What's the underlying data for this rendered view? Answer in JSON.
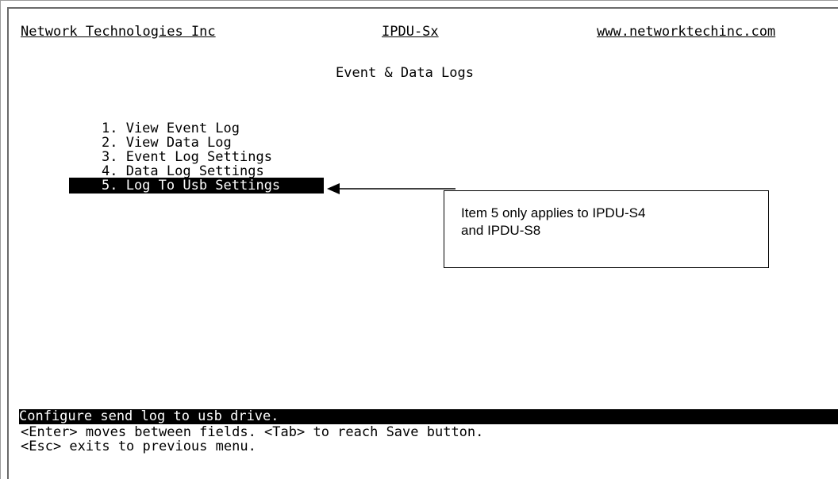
{
  "header": {
    "company": "Network Technologies Inc",
    "product": "IPDU-Sx",
    "website": "www.networktechinc.com"
  },
  "title": "Event & Data Logs",
  "menu": {
    "items": [
      {
        "label": "1. View Event Log"
      },
      {
        "label": "2. View Data Log"
      },
      {
        "label": "3. Event Log Settings"
      },
      {
        "label": "4. Data Log Settings"
      },
      {
        "label": "5. Log To Usb Settings"
      }
    ],
    "selected_index": 4
  },
  "callout": {
    "text": "Item 5 only applies to IPDU-S4\nand IPDU-S8"
  },
  "status": "Configure send log to usb drive.",
  "help": [
    "<Enter> moves between fields. <Tab> to reach Save button.",
    "<Esc> exits to previous menu."
  ],
  "colors": {
    "background": "#ffffff",
    "text": "#000000",
    "highlight_bg": "#000000",
    "highlight_fg": "#ffffff"
  }
}
